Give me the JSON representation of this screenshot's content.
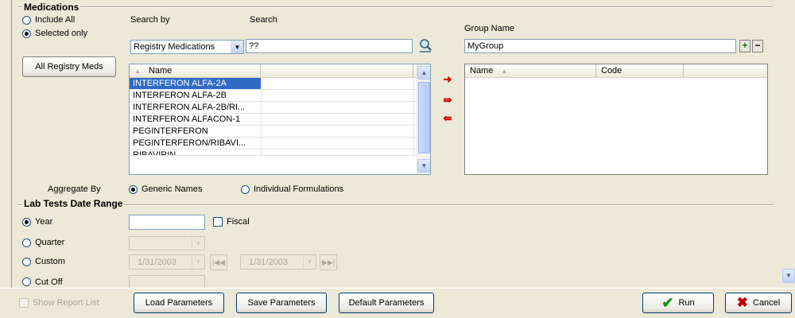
{
  "medications": {
    "title": "Medications",
    "include_all": "Include All",
    "selected_only": "Selected only",
    "all_registry_meds": "All Registry Meds",
    "search_by_label": "Search by",
    "search_label": "Search",
    "search_by_value": "Registry Medications",
    "search_value": "??",
    "list_header_name": "Name",
    "list_items": [
      "INTERFERON ALFA-2A",
      "INTERFERON ALFA-2B",
      "INTERFERON ALFA-2B/RI...",
      "INTERFERON ALFACON-1",
      "PEGINTERFERON",
      "PEGINTERFERON/RIBAVI...",
      "RIBAVIRIN"
    ],
    "group_name_label": "Group Name",
    "group_name_value": "MyGroup",
    "group_header_name": "Name",
    "group_header_code": "Code",
    "aggregate_by_label": "Aggregate By",
    "generic_names": "Generic Names",
    "individual_formulations": "Individual Formulations"
  },
  "lab_tests": {
    "title": "Lab Tests Date Range",
    "year": "Year",
    "quarter": "Quarter",
    "custom": "Custom",
    "cut_off": "Cut Off",
    "fiscal": "Fiscal",
    "year_value": "",
    "date_start": "1/31/2003",
    "date_end": "1/31/2003"
  },
  "footer": {
    "show_report_list": "Show Report List",
    "load": "Load Parameters",
    "save": "Save Parameters",
    "default": "Default Parameters",
    "run": "Run",
    "cancel": "Cancel"
  },
  "colors": {
    "selection": "#316ac5",
    "accent_red": "#d40000",
    "run_green": "#1a8f1a"
  }
}
